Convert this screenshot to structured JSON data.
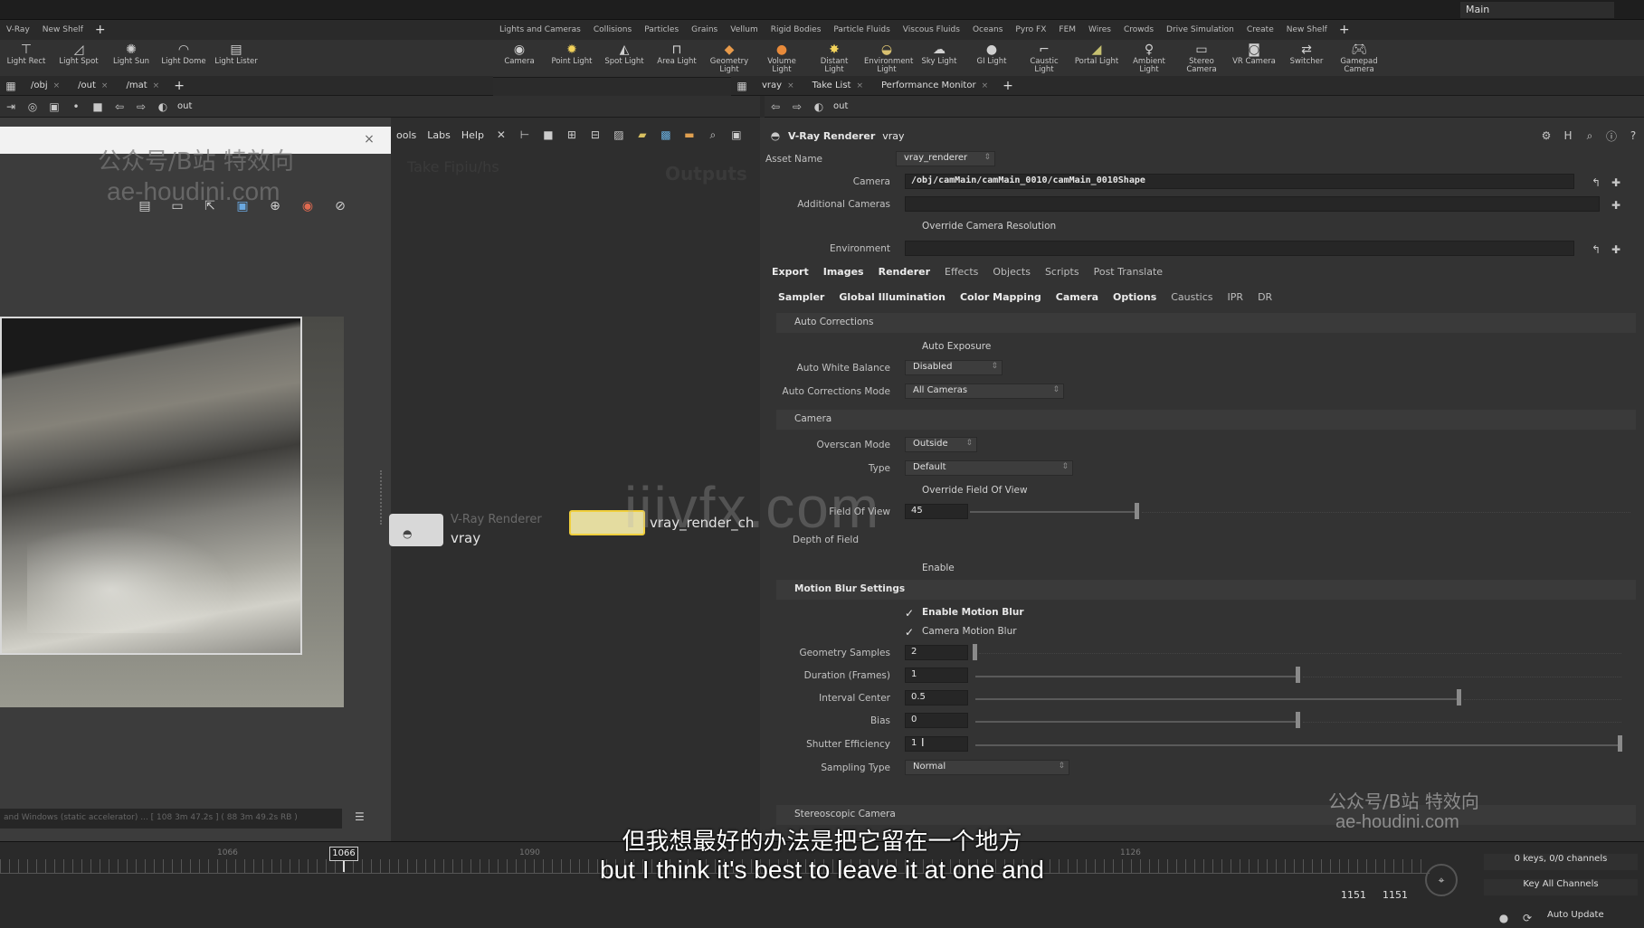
{
  "desktop": {
    "label": "Main"
  },
  "shelf_left": {
    "tabs": [
      "V-Ray",
      "New Shelf"
    ],
    "tools": [
      "Light Rect",
      "Light Spot",
      "Light Sun",
      "Light Dome",
      "Light Lister"
    ]
  },
  "shelf_right": {
    "tabs": [
      "Lights and Cameras",
      "Collisions",
      "Particles",
      "Grains",
      "Vellum",
      "Rigid Bodies",
      "Particle Fluids",
      "Viscous Fluids",
      "Oceans",
      "Pyro FX",
      "FEM",
      "Wires",
      "Crowds",
      "Drive Simulation",
      "Create",
      "New Shelf"
    ],
    "tools": [
      "Camera",
      "Point Light",
      "Spot Light",
      "Area Light",
      "Geometry Light",
      "Volume Light",
      "Distant Light",
      "Environment Light",
      "Sky Light",
      "GI Light",
      "Caustic Light",
      "Portal Light",
      "Ambient Light",
      "Stereo Camera",
      "VR Camera",
      "Switcher",
      "Gamepad Camera"
    ]
  },
  "pane_tabs_left": [
    "/obj",
    "/out",
    "/mat"
  ],
  "pane_tabs_right": [
    "vray",
    "Take List",
    "Performance Monitor"
  ],
  "nav_left": {
    "path": "out"
  },
  "nav_right": {
    "path": "out"
  },
  "network": {
    "menu": [
      "ools",
      "Labs",
      "Help"
    ],
    "watermark_left": "Take Fipiu/hs",
    "watermark_right": "Outputs",
    "node_vray_type": "V-Ray Renderer",
    "node_vray_name": "vray",
    "node_chain_name": "vray_render_ch"
  },
  "viewer": {
    "status": "and Windows (static accelerator) ...  [ 108  3m 47.2s ]  ( 88  3m 49.2s RB )"
  },
  "params": {
    "header_type": "V-Ray Renderer",
    "header_name": "vray",
    "asset_name_label": "Asset Name",
    "asset_name_value": "vray_renderer",
    "camera_label": "Camera",
    "camera_value": "/obj/camMain/camMain_0010/camMain_0010Shape",
    "additional_cameras_label": "Additional Cameras",
    "override_cam_res": "Override Camera Resolution",
    "environment_label": "Environment",
    "tabs1": [
      "Export",
      "Images",
      "Renderer",
      "Effects",
      "Objects",
      "Scripts",
      "Post Translate"
    ],
    "tabs2": [
      "Sampler",
      "Global Illumination",
      "Color Mapping",
      "Camera",
      "Options",
      "Caustics",
      "IPR",
      "DR"
    ],
    "sec_auto_corrections": "Auto Corrections",
    "auto_exposure": "Auto Exposure",
    "auto_wb_label": "Auto White Balance",
    "auto_wb_value": "Disabled",
    "auto_corr_mode_label": "Auto Corrections Mode",
    "auto_corr_mode_value": "All Cameras",
    "sec_camera": "Camera",
    "overscan_label": "Overscan Mode",
    "overscan_value": "Outside",
    "type_label": "Type",
    "type_value": "Default",
    "override_fov": "Override Field Of View",
    "fov_label": "Field Of View",
    "fov_value": "45",
    "dof_label": "Depth of Field",
    "dof_enable": "Enable",
    "sec_motion_blur": "Motion Blur Settings",
    "enable_mb": "Enable Motion Blur",
    "camera_mb": "Camera Motion Blur",
    "geo_samples_label": "Geometry Samples",
    "geo_samples_value": "2",
    "duration_label": "Duration (Frames)",
    "duration_value": "1",
    "interval_label": "Interval Center",
    "interval_value": "0.5",
    "bias_label": "Bias",
    "bias_value": "0",
    "shutter_label": "Shutter Efficiency",
    "shutter_value": "1",
    "sampling_type_label": "Sampling Type",
    "sampling_type_value": "Normal",
    "sec_stereo": "Stereoscopic Camera"
  },
  "timeline": {
    "current_frame": "1066",
    "marks": [
      "1066",
      "1090",
      "1126"
    ],
    "end1": "1151",
    "end2": "1151",
    "keys": "0 keys, 0/0 channels",
    "key_all": "Key All Channels",
    "auto_update": "Auto Update"
  },
  "subtitles": {
    "cn": "但我想最好的办法是把它留在一个地方",
    "en": "but I think it's best to leave it at one and"
  },
  "watermarks": {
    "top_cn": "公众号/B站 特效向",
    "top_en": "ae-houdini.com",
    "bottom_cn": "公众号/B站 特效向",
    "bottom_en": "ae-houdini.com",
    "center": "iiivfx.com"
  }
}
